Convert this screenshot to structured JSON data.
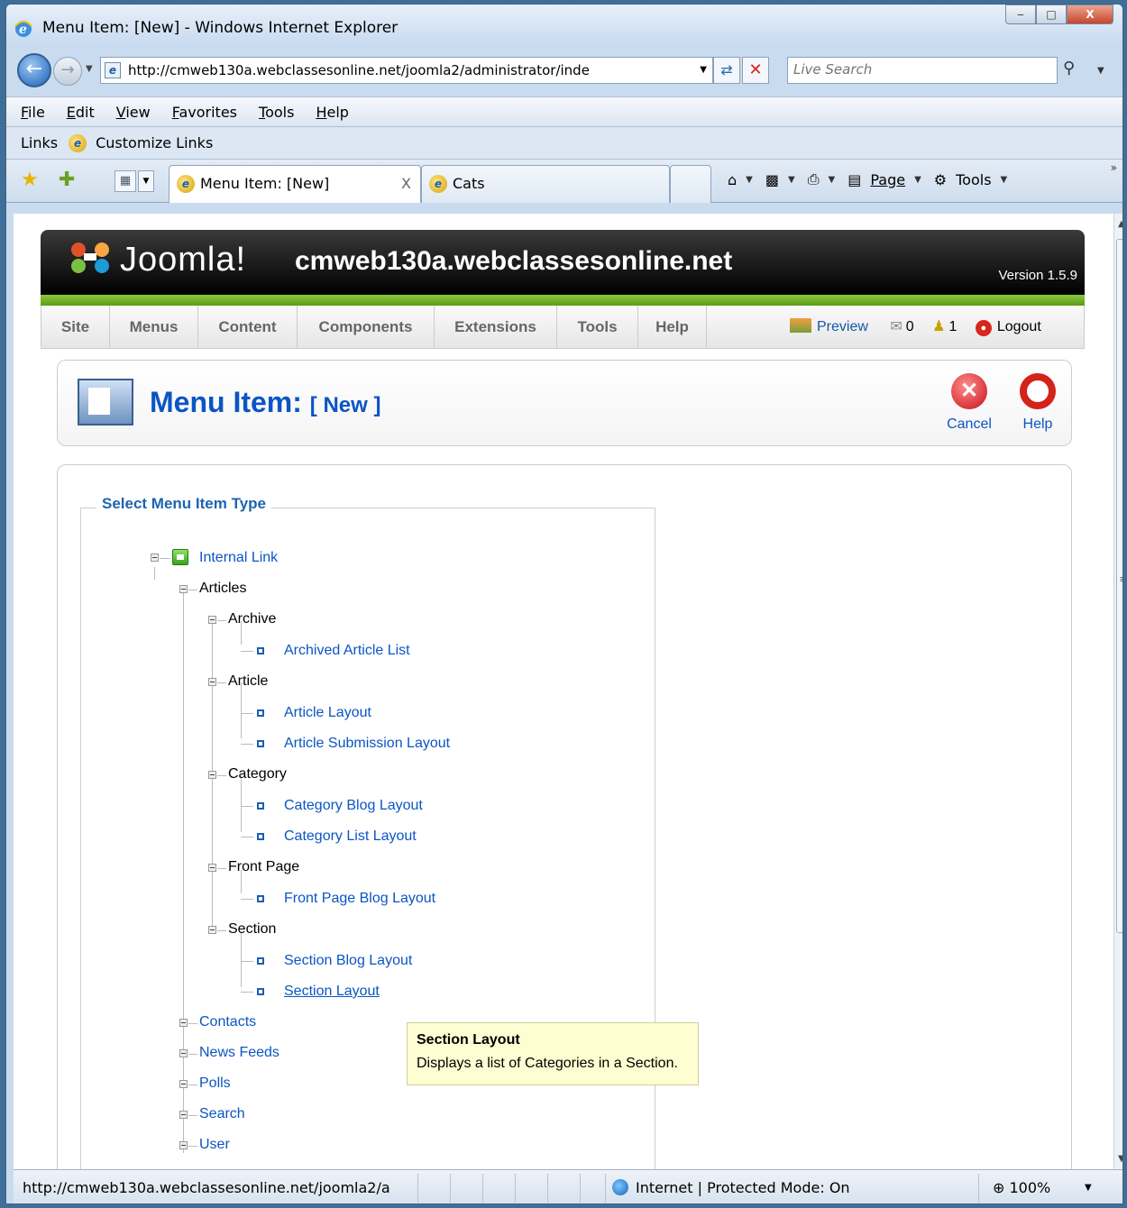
{
  "window": {
    "title": "Menu Item: [New] - Windows Internet Explorer",
    "minimize": "‒",
    "maximize": "□",
    "close": "X"
  },
  "address": {
    "url": "http://cmweb130a.webclassesonline.net/joomla2/administrator/inde",
    "search_placeholder": "Live Search"
  },
  "menubar": [
    "File",
    "Edit",
    "View",
    "Favorites",
    "Tools",
    "Help"
  ],
  "links": {
    "label": "Links",
    "item": "Customize Links"
  },
  "tabs": [
    {
      "label": "Menu Item: [New]",
      "active": true,
      "close": "X"
    },
    {
      "label": "Cats",
      "active": false
    }
  ],
  "commandbar": {
    "page": "Page",
    "tools": "Tools"
  },
  "joomla": {
    "logo_text": "Joomla!",
    "site_name": "cmweb130a.webclassesonline.net",
    "version": "Version 1.5.9",
    "menu": [
      "Site",
      "Menus",
      "Content",
      "Components",
      "Extensions",
      "Tools",
      "Help"
    ],
    "preview": "Preview",
    "messages_count": "0",
    "users_count": "1",
    "logout": "Logout",
    "page_title": "Menu Item:",
    "page_title_suffix": "[ New ]",
    "cancel": "Cancel",
    "help": "Help",
    "fieldset_legend": "Select Menu Item Type",
    "accent_color": "#0b55c4",
    "green_bar_color": "#6fb32a"
  },
  "tree": {
    "internal_link": "Internal Link",
    "articles": "Articles",
    "archive": "Archive",
    "archived_article_list": "Archived Article List",
    "article": "Article",
    "article_layout": "Article Layout",
    "article_submission_layout": "Article Submission Layout",
    "category": "Category",
    "category_blog_layout": "Category Blog Layout",
    "category_list_layout": "Category List Layout",
    "front_page": "Front Page",
    "front_page_blog_layout": "Front Page Blog Layout",
    "section": "Section",
    "section_blog_layout": "Section Blog Layout",
    "section_layout": "Section Layout",
    "contacts": "Contacts",
    "news_feeds": "News Feeds",
    "polls": "Polls",
    "search": "Search",
    "user": "User"
  },
  "tooltip": {
    "title": "Section Layout",
    "body": "Displays a list of Categories in a Section."
  },
  "status": {
    "url": "http://cmweb130a.webclassesonline.net/joomla2/a",
    "zone": "Internet | Protected Mode: On",
    "zoom": "100%"
  }
}
